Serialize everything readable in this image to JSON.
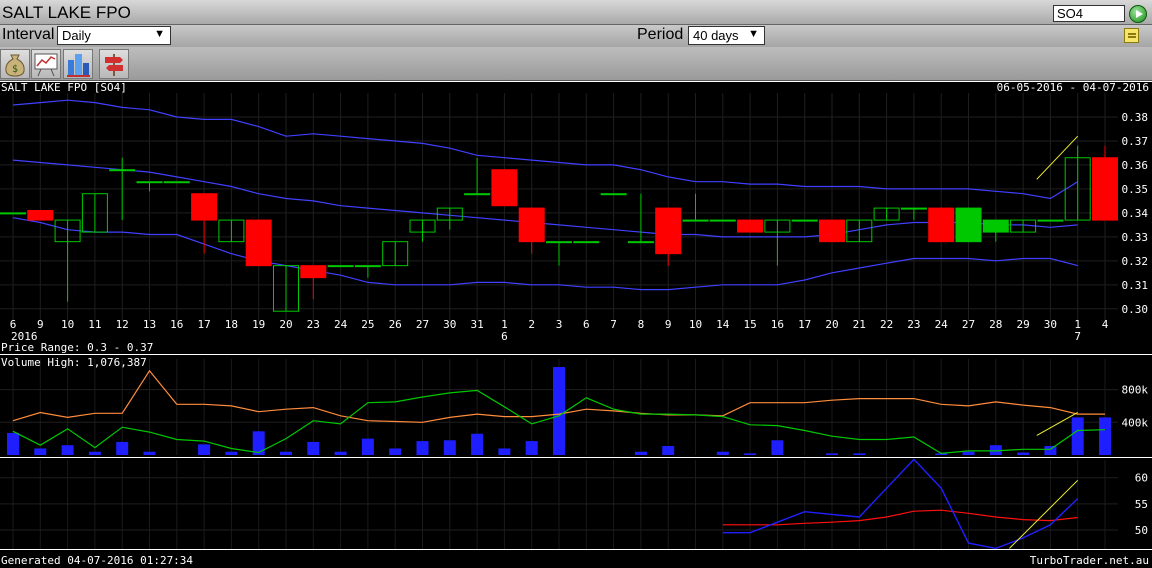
{
  "header": {
    "title": "SALT LAKE FPO",
    "symbol_value": "SO4"
  },
  "controls": {
    "interval_label": "Interval",
    "interval_value": "Daily",
    "period_label": "Period",
    "period_value": "40 days"
  },
  "toolbar": {
    "icons": [
      "money-bag-icon",
      "chart-board-icon",
      "buildings-icon",
      "signpost-icon"
    ]
  },
  "chart_caption": {
    "security": "SALT LAKE FPO [SO4]",
    "date_range": "06-05-2016 - 04-07-2016",
    "price_range": "Price Range: 0.3 - 0.37",
    "volume_high": "Volume High: 1,076,387",
    "generated": "Generated 04-07-2016 01:27:34",
    "site": "TurboTrader.net.au"
  },
  "colors": {
    "up": "#00c800",
    "down": "#ff0000",
    "band": "#4040ff",
    "volume": "#1e1eff",
    "vol_avg": "#ff8c3c",
    "vol_line": "#00c800",
    "osc_blue": "#2020ff",
    "osc_red": "#ff1010",
    "trend": "#f0f030"
  },
  "chart_data": {
    "type": "candlestick",
    "x_labels": [
      "6",
      "9",
      "10",
      "11",
      "12",
      "13",
      "16",
      "17",
      "18",
      "19",
      "20",
      "23",
      "24",
      "25",
      "26",
      "27",
      "30",
      "31",
      "1",
      "2",
      "3",
      "6",
      "7",
      "8",
      "9",
      "10",
      "14",
      "15",
      "16",
      "17",
      "20",
      "21",
      "22",
      "23",
      "24",
      "27",
      "28",
      "29",
      "30",
      "1",
      "4"
    ],
    "x_sublabels": [
      {
        "index": 0,
        "text": "2016"
      },
      {
        "index": 18,
        "text": "6"
      },
      {
        "index": 39,
        "text": "7"
      }
    ],
    "price_axis": {
      "ticks": [
        0.3,
        0.31,
        0.32,
        0.33,
        0.34,
        0.35,
        0.36,
        0.37,
        0.38
      ],
      "ylim": [
        0.297,
        0.39
      ]
    },
    "candles": [
      {
        "o": 0.34,
        "h": 0.34,
        "l": 0.34,
        "c": 0.34
      },
      {
        "o": 0.341,
        "h": 0.341,
        "l": 0.337,
        "c": 0.337
      },
      {
        "o": 0.328,
        "h": 0.337,
        "l": 0.303,
        "c": 0.337
      },
      {
        "o": 0.332,
        "h": 0.348,
        "l": 0.332,
        "c": 0.348
      },
      {
        "o": 0.358,
        "h": 0.363,
        "l": 0.337,
        "c": 0.358
      },
      {
        "o": 0.353,
        "h": 0.353,
        "l": 0.349,
        "c": 0.353
      },
      {
        "o": 0.353,
        "h": 0.353,
        "l": 0.353,
        "c": 0.353
      },
      {
        "o": 0.348,
        "h": 0.348,
        "l": 0.323,
        "c": 0.337
      },
      {
        "o": 0.328,
        "h": 0.337,
        "l": 0.328,
        "c": 0.337
      },
      {
        "o": 0.337,
        "h": 0.337,
        "l": 0.318,
        "c": 0.318
      },
      {
        "o": 0.299,
        "h": 0.318,
        "l": 0.299,
        "c": 0.318
      },
      {
        "o": 0.318,
        "h": 0.318,
        "l": 0.304,
        "c": 0.313
      },
      {
        "o": 0.318,
        "h": 0.318,
        "l": 0.318,
        "c": 0.318
      },
      {
        "o": 0.318,
        "h": 0.318,
        "l": 0.313,
        "c": 0.318
      },
      {
        "o": 0.318,
        "h": 0.328,
        "l": 0.318,
        "c": 0.328
      },
      {
        "o": 0.332,
        "h": 0.337,
        "l": 0.328,
        "c": 0.337
      },
      {
        "o": 0.337,
        "h": 0.342,
        "l": 0.333,
        "c": 0.342
      },
      {
        "o": 0.348,
        "h": 0.363,
        "l": 0.348,
        "c": 0.348
      },
      {
        "o": 0.358,
        "h": 0.358,
        "l": 0.343,
        "c": 0.343
      },
      {
        "o": 0.342,
        "h": 0.342,
        "l": 0.323,
        "c": 0.328
      },
      {
        "o": 0.328,
        "h": 0.328,
        "l": 0.318,
        "c": 0.328
      },
      {
        "o": 0.328,
        "h": 0.328,
        "l": 0.328,
        "c": 0.328
      },
      {
        "o": 0.348,
        "h": 0.348,
        "l": 0.348,
        "c": 0.348
      },
      {
        "o": 0.328,
        "h": 0.348,
        "l": 0.328,
        "c": 0.328
      },
      {
        "o": 0.342,
        "h": 0.342,
        "l": 0.318,
        "c": 0.323
      },
      {
        "o": 0.337,
        "h": 0.348,
        "l": 0.337,
        "c": 0.337
      },
      {
        "o": 0.337,
        "h": 0.337,
        "l": 0.337,
        "c": 0.337
      },
      {
        "o": 0.337,
        "h": 0.337,
        "l": 0.332,
        "c": 0.332
      },
      {
        "o": 0.332,
        "h": 0.337,
        "l": 0.318,
        "c": 0.337
      },
      {
        "o": 0.337,
        "h": 0.337,
        "l": 0.337,
        "c": 0.337
      },
      {
        "o": 0.337,
        "h": 0.337,
        "l": 0.328,
        "c": 0.328
      },
      {
        "o": 0.328,
        "h": 0.337,
        "l": 0.328,
        "c": 0.337
      },
      {
        "o": 0.337,
        "h": 0.342,
        "l": 0.337,
        "c": 0.342
      },
      {
        "o": 0.342,
        "h": 0.342,
        "l": 0.337,
        "c": 0.342
      },
      {
        "o": 0.342,
        "h": 0.342,
        "l": 0.328,
        "c": 0.328
      },
      {
        "o": 0.328,
        "h": 0.342,
        "l": 0.328,
        "c": 0.342
      },
      {
        "o": 0.332,
        "h": 0.337,
        "l": 0.328,
        "c": 0.337
      },
      {
        "o": 0.332,
        "h": 0.337,
        "l": 0.332,
        "c": 0.337
      },
      {
        "o": 0.337,
        "h": 0.337,
        "l": 0.337,
        "c": 0.337
      },
      {
        "o": 0.337,
        "h": 0.368,
        "l": 0.337,
        "c": 0.363
      },
      {
        "o": 0.363,
        "h": 0.368,
        "l": 0.337,
        "c": 0.337
      }
    ],
    "bollinger_upper": [
      0.385,
      0.386,
      0.387,
      0.386,
      0.384,
      0.383,
      0.38,
      0.379,
      0.379,
      0.376,
      0.372,
      0.373,
      0.372,
      0.371,
      0.37,
      0.369,
      0.367,
      0.364,
      0.363,
      0.362,
      0.361,
      0.36,
      0.36,
      0.358,
      0.355,
      0.353,
      0.353,
      0.352,
      0.352,
      0.351,
      0.351,
      0.351,
      0.35,
      0.35,
      0.35,
      0.35,
      0.349,
      0.348,
      0.346,
      0.353,
      null
    ],
    "bollinger_middle": [
      0.362,
      0.361,
      0.36,
      0.359,
      0.358,
      0.357,
      0.355,
      0.353,
      0.351,
      0.348,
      0.346,
      0.345,
      0.343,
      0.342,
      0.341,
      0.34,
      0.339,
      0.338,
      0.337,
      0.336,
      0.335,
      0.334,
      0.333,
      0.332,
      0.331,
      0.331,
      0.33,
      0.33,
      0.33,
      0.33,
      0.331,
      0.333,
      0.335,
      0.336,
      0.336,
      0.336,
      0.335,
      0.335,
      0.334,
      0.335,
      null
    ],
    "bollinger_lower": [
      0.338,
      0.336,
      0.333,
      0.332,
      0.332,
      0.331,
      0.331,
      0.327,
      0.323,
      0.32,
      0.318,
      0.316,
      0.314,
      0.311,
      0.31,
      0.31,
      0.31,
      0.311,
      0.311,
      0.31,
      0.31,
      0.309,
      0.309,
      0.308,
      0.308,
      0.309,
      0.31,
      0.31,
      0.31,
      0.312,
      0.315,
      0.317,
      0.319,
      0.321,
      0.321,
      0.321,
      0.32,
      0.321,
      0.321,
      0.318,
      null
    ],
    "price_trend": [
      [
        37.5,
        0.354
      ],
      [
        39.0,
        0.372
      ]
    ],
    "volume_axis": {
      "ticks": [
        {
          "v": 400000,
          "label": "400k"
        },
        {
          "v": 800000,
          "label": "800k"
        }
      ],
      "ylim": [
        0,
        1076387
      ]
    },
    "volume": [
      270000,
      80000,
      120000,
      40000,
      160000,
      40000,
      0,
      130000,
      40000,
      290000,
      40000,
      160000,
      40000,
      200000,
      80000,
      170000,
      180000,
      260000,
      80000,
      170000,
      1076387,
      0,
      0,
      40000,
      110000,
      0,
      40000,
      20000,
      180000,
      0,
      20000,
      20000,
      0,
      0,
      20000,
      40000,
      120000,
      30000,
      110000,
      460000,
      460000
    ],
    "volume_avg": [
      420000,
      520000,
      460000,
      510000,
      510000,
      1030000,
      620000,
      620000,
      600000,
      530000,
      560000,
      580000,
      480000,
      420000,
      410000,
      400000,
      460000,
      500000,
      470000,
      470000,
      500000,
      560000,
      540000,
      510000,
      490000,
      490000,
      480000,
      640000,
      640000,
      640000,
      670000,
      690000,
      690000,
      690000,
      620000,
      600000,
      650000,
      610000,
      580000,
      500000,
      500000
    ],
    "volume_line": [
      290000,
      120000,
      320000,
      90000,
      340000,
      280000,
      190000,
      170000,
      80000,
      30000,
      200000,
      420000,
      380000,
      640000,
      650000,
      710000,
      760000,
      790000,
      590000,
      380000,
      480000,
      700000,
      560000,
      500000,
      500000,
      490000,
      470000,
      370000,
      360000,
      300000,
      230000,
      190000,
      190000,
      220000,
      20000,
      50000,
      50000,
      70000,
      70000,
      300000,
      310000
    ],
    "volume_trend": [
      [
        37.5,
        240000
      ],
      [
        39.0,
        520000
      ]
    ],
    "osc_axis": {
      "ticks": [
        50,
        55,
        60
      ],
      "ylim": [
        46,
        63
      ]
    },
    "osc_blue": [
      null,
      null,
      null,
      null,
      null,
      null,
      null,
      null,
      null,
      null,
      null,
      null,
      null,
      null,
      null,
      null,
      null,
      null,
      null,
      null,
      null,
      null,
      null,
      null,
      null,
      null,
      49.5,
      49.5,
      51.5,
      53.5,
      53.0,
      52.5,
      58.0,
      63.5,
      58.0,
      47.5,
      46.5,
      48.5,
      51.0,
      56.0,
      null
    ],
    "osc_red": [
      null,
      null,
      null,
      null,
      null,
      null,
      null,
      null,
      null,
      null,
      null,
      null,
      null,
      null,
      null,
      null,
      null,
      null,
      null,
      null,
      null,
      null,
      null,
      null,
      null,
      null,
      51.0,
      51.0,
      51.0,
      51.3,
      51.5,
      51.8,
      52.5,
      53.6,
      53.8,
      53.2,
      52.5,
      52.0,
      51.8,
      52.4,
      null
    ],
    "osc_trend": [
      [
        36.5,
        46.5
      ],
      [
        39.0,
        59.5
      ]
    ]
  }
}
